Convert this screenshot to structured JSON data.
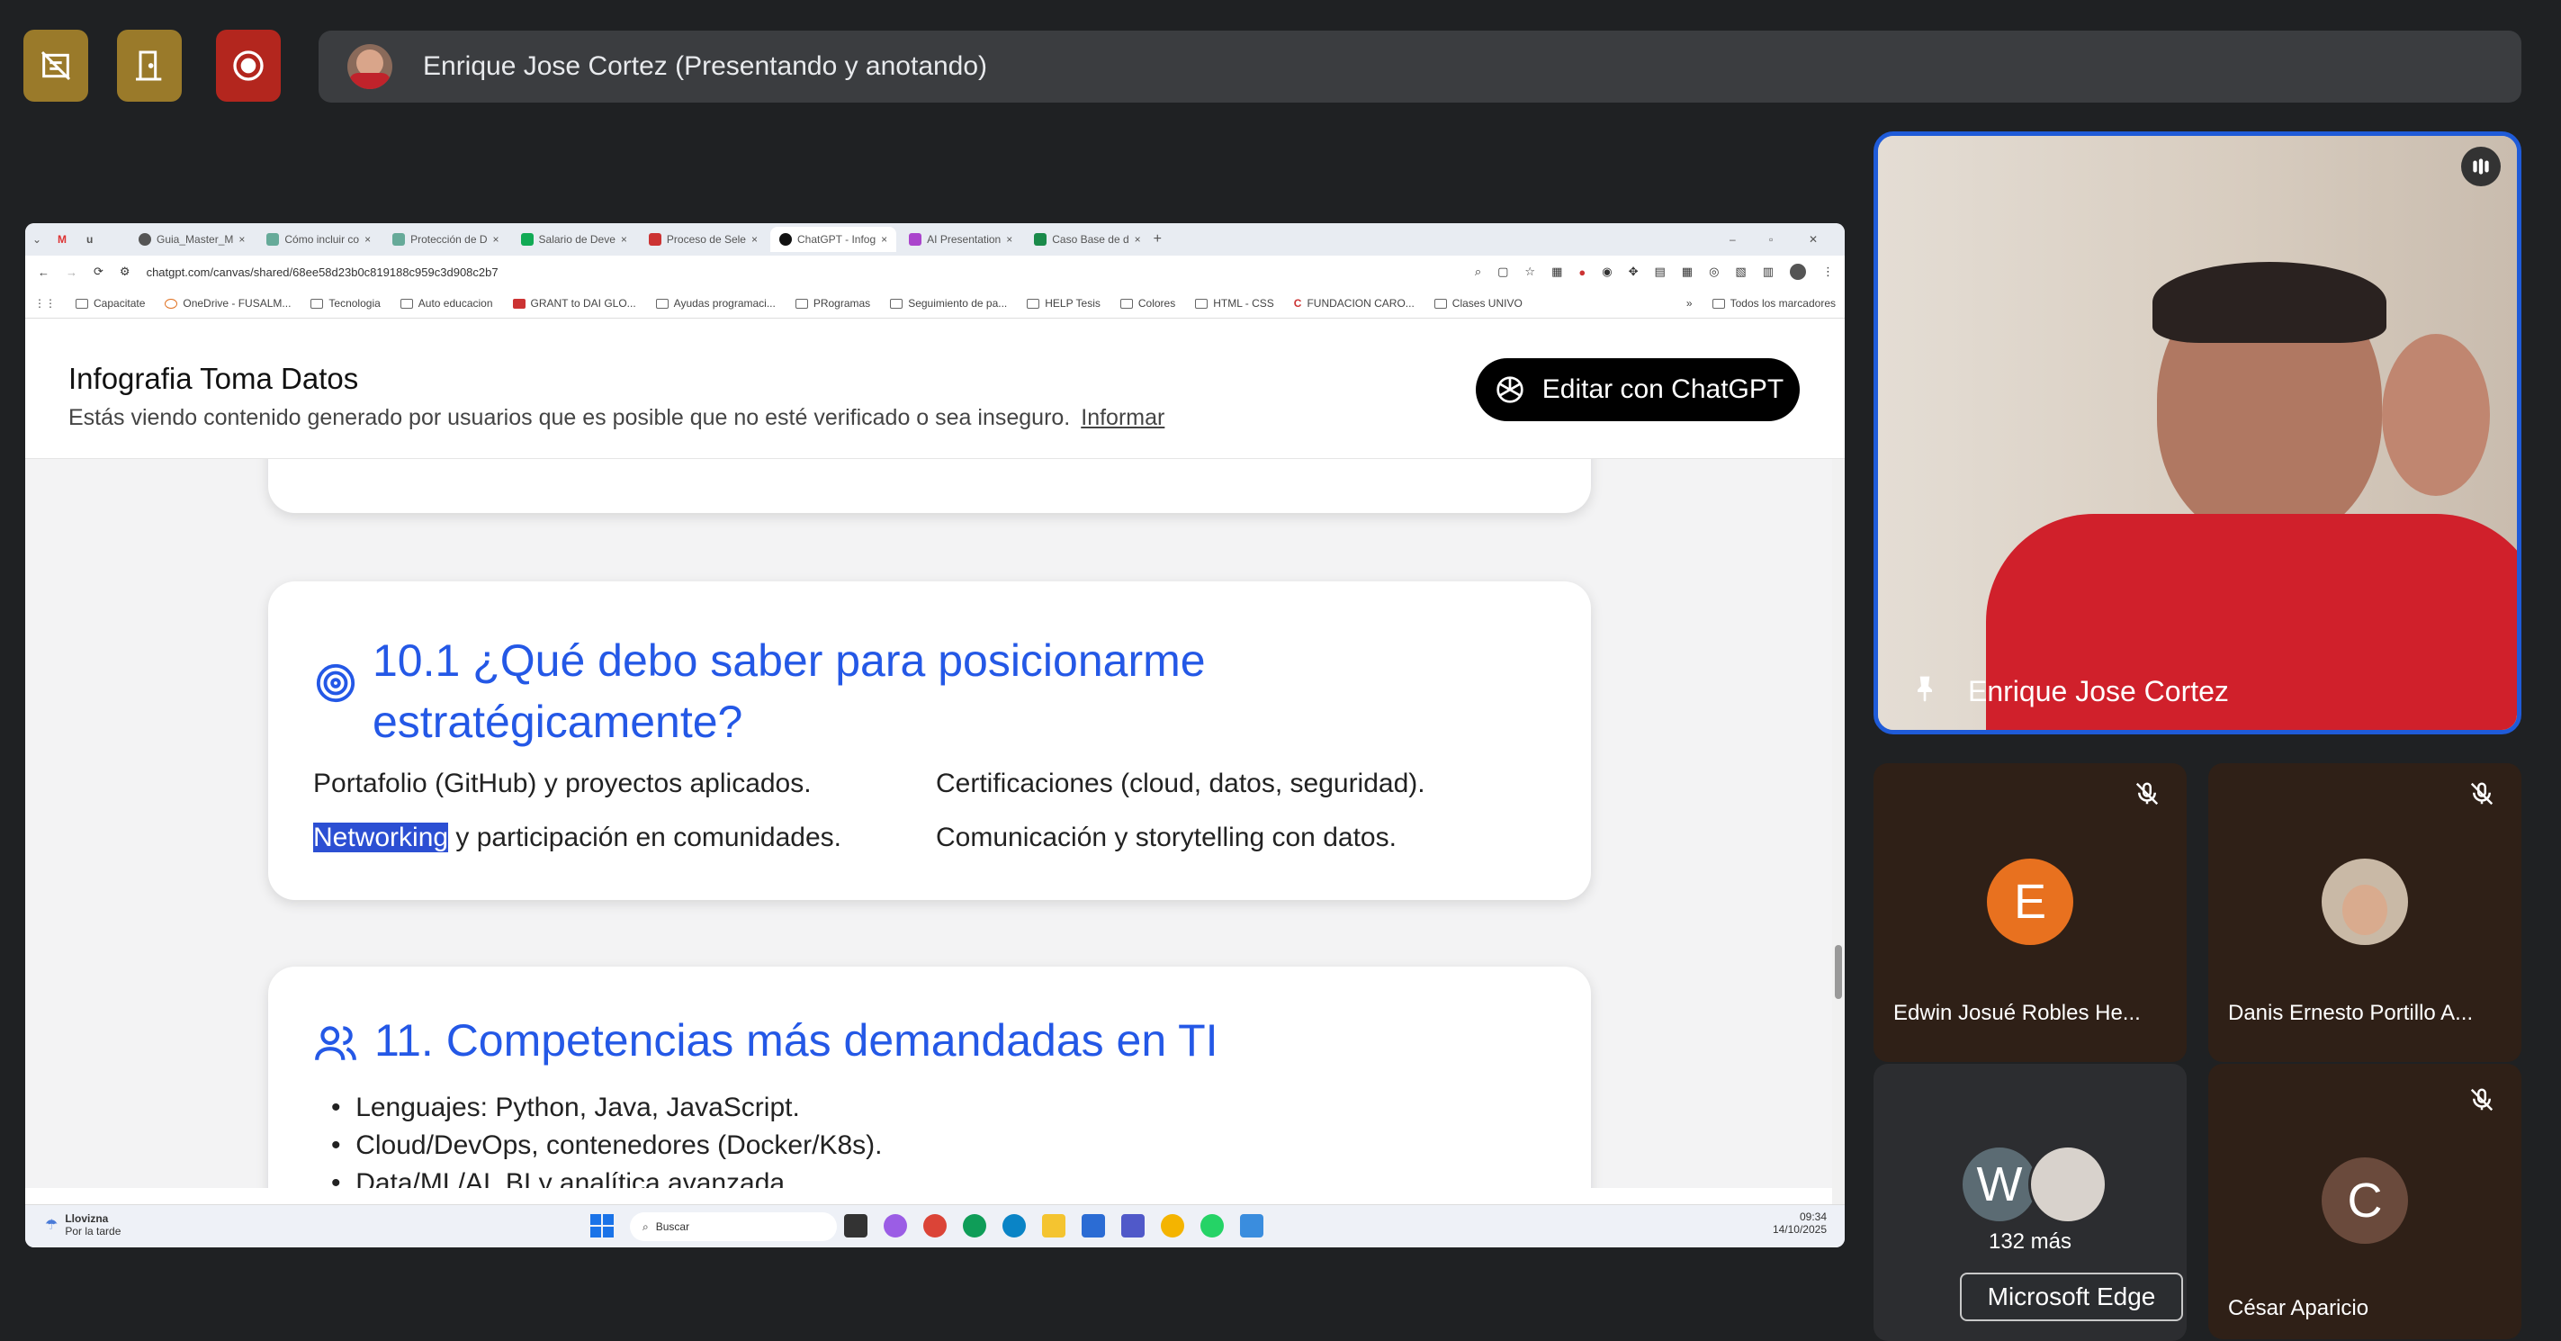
{
  "top_bar": {
    "presenter_text": "Enrique Jose Cortez (Presentando y anotando)",
    "buttons": [
      {
        "icon": "no-annotate-icon",
        "color": "#9a7a2a"
      },
      {
        "icon": "exit-icon",
        "color": "#9a7a2a"
      },
      {
        "icon": "record-icon",
        "color": "#b3261e"
      }
    ]
  },
  "browser": {
    "tabs": [
      "Guia_Master_M",
      "Cómo incluir co",
      "Protección de D",
      "Salario de Deve",
      "Proceso de Sele",
      "ChatGPT - Infog",
      "AI Presentation",
      "Caso Base de d"
    ],
    "active_tab_index": 5,
    "url": "chatgpt.com/canvas/shared/68ee58d23b0c819188c959c3d908c2b7",
    "bookmarks": [
      "Capacitate",
      "OneDrive - FUSALM...",
      "Tecnologia",
      "Auto educacion",
      "GRANT to DAI GLO...",
      "Ayudas programaci...",
      "PRogramas",
      "Seguimiento de pa...",
      "HELP Tesis",
      "Colores",
      "HTML - CSS",
      "FUNDACION CARO...",
      "Clases UNIVO"
    ],
    "bookmarks_right": "Todos los marcadores"
  },
  "page": {
    "title": "Infografia Toma Datos",
    "subtitle": "Estás viendo contenido generado por usuarios que es posible que no esté verificado o sea inseguro.",
    "report_link": "Informar",
    "edit_button": "Editar con ChatGPT",
    "section_10_1": {
      "heading_line1": "10.1 ¿Qué debo saber para posicionarme",
      "heading_line2": "estratégicamente?",
      "items": [
        "Portafolio (GitHub) y proyectos aplicados.",
        "Certificaciones (cloud, datos, seguridad).",
        "Comunicación y storytelling con datos."
      ],
      "selected_word": "Networking",
      "item3_rest": " y participación en comunidades."
    },
    "section_11": {
      "heading": "11. Competencias más demandadas en TI",
      "bullets": [
        "Lenguajes: Python, Java, JavaScript.",
        "Cloud/DevOps, contenedores (Docker/K8s).",
        "Data/ML/AI, BI y analítica avanzada."
      ]
    }
  },
  "taskbar": {
    "weather": "Llovizna",
    "weather_sub": "Por la tarde",
    "search": "Buscar",
    "time": "09:34",
    "date": "14/10/2025"
  },
  "participants": {
    "main": {
      "name": "Enrique Jose Cortez"
    },
    "tiles": [
      {
        "name": "Edwin Josué Robles He...",
        "initial": "E",
        "color": "#e8711f"
      },
      {
        "name": "Danis Ernesto Portillo A...",
        "initial": "",
        "color": "#c9b9a6"
      },
      {
        "name": "132 más",
        "initial": "W",
        "color": "#5b6b73"
      },
      {
        "name": "César Aparicio",
        "initial": "C",
        "color": "#6a4a3c"
      }
    ],
    "tooltip": "Microsoft Edge"
  }
}
